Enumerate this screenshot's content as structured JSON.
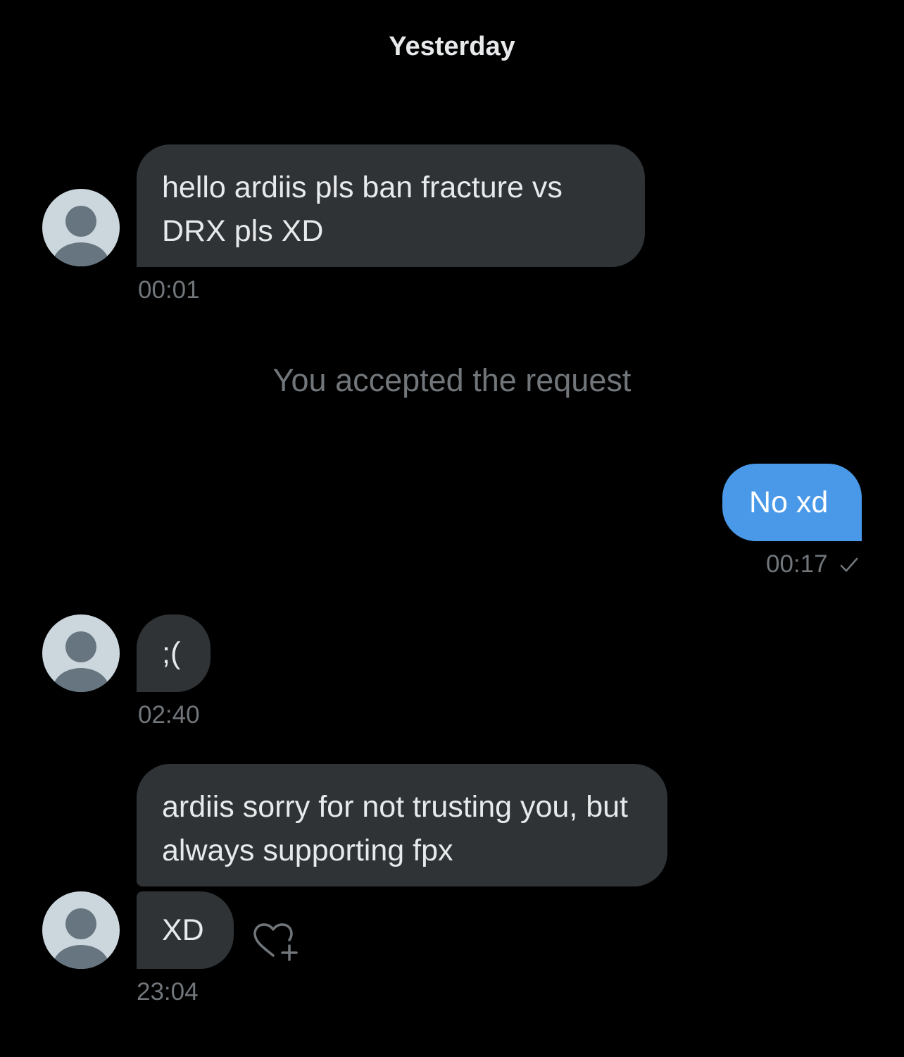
{
  "conversation": {
    "date_divider": "Yesterday",
    "system_note": "You accepted the request",
    "messages": [
      {
        "text": "hello ardiis pls ban fracture vs DRX pls XD",
        "time": "00:01"
      },
      {
        "text": "No xd",
        "time": "00:17"
      },
      {
        "text": ";(",
        "time": "02:40"
      },
      {
        "text": "ardiis sorry for not trusting you, but always supporting fpx"
      },
      {
        "text": "XD",
        "time": "23:04"
      }
    ]
  },
  "icons": {
    "read_receipt": "check-icon",
    "react": "heart-plus-icon",
    "avatar": "default-avatar-icon"
  },
  "colors": {
    "background": "#000000",
    "incoming_bubble": "#2f3336",
    "outgoing_bubble": "#4a99e9",
    "muted_text": "#71767b"
  }
}
